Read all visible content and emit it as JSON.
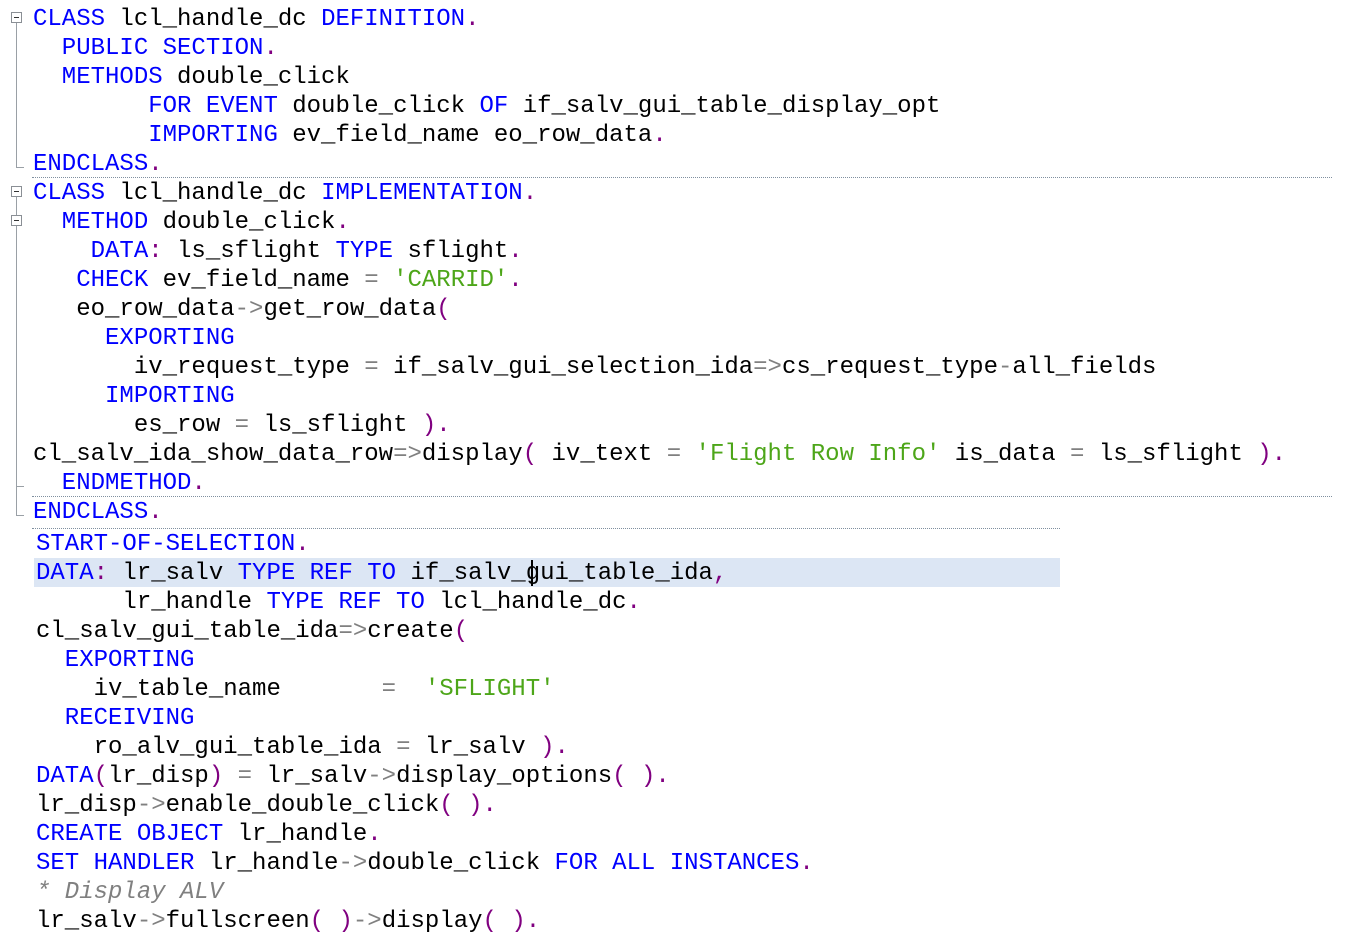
{
  "colors": {
    "keyword": "#0000ff",
    "string": "#4da619",
    "operator": "#808080",
    "punctuation": "#800080",
    "comment": "#808080",
    "current_line": "#dce6f4"
  },
  "lines": [
    [
      [
        "k",
        "CLASS"
      ],
      [
        "i",
        " lcl_handle_dc "
      ],
      [
        "k",
        "DEFINITION"
      ],
      [
        "p",
        "."
      ]
    ],
    [
      [
        "k",
        "  PUBLIC SECTION"
      ],
      [
        "p",
        "."
      ]
    ],
    [
      [
        "k",
        "  METHODS"
      ],
      [
        "i",
        " double_click"
      ]
    ],
    [
      [
        "i",
        "        "
      ],
      [
        "k",
        "FOR EVENT"
      ],
      [
        "i",
        " double_click "
      ],
      [
        "k",
        "OF"
      ],
      [
        "i",
        " if_salv_gui_table_display_opt"
      ]
    ],
    [
      [
        "i",
        "        "
      ],
      [
        "k",
        "IMPORTING"
      ],
      [
        "i",
        " ev_field_name eo_row_data"
      ],
      [
        "p",
        "."
      ]
    ],
    [
      [
        "k",
        "ENDCLASS"
      ],
      [
        "p",
        "."
      ]
    ],
    [
      [
        "k",
        "CLASS"
      ],
      [
        "i",
        " lcl_handle_dc "
      ],
      [
        "k",
        "IMPLEMENTATION"
      ],
      [
        "p",
        "."
      ]
    ],
    [
      [
        "k",
        "  METHOD"
      ],
      [
        "i",
        " double_click"
      ],
      [
        "p",
        "."
      ]
    ],
    [
      [
        "k",
        "    DATA"
      ],
      [
        "p",
        ":"
      ],
      [
        "i",
        " ls_sflight "
      ],
      [
        "k",
        "TYPE"
      ],
      [
        "i",
        " sflight"
      ],
      [
        "p",
        "."
      ]
    ],
    [
      [
        "k",
        "   CHECK"
      ],
      [
        "i",
        " ev_field_name "
      ],
      [
        "o",
        "="
      ],
      [
        "i",
        " "
      ],
      [
        "s",
        "'CARRID'"
      ],
      [
        "p",
        "."
      ]
    ],
    [
      [
        "i",
        "   eo_row_data"
      ],
      [
        "o",
        "->"
      ],
      [
        "i",
        "get_row_data"
      ],
      [
        "p",
        "("
      ]
    ],
    [
      [
        "k",
        "     EXPORTING"
      ]
    ],
    [
      [
        "i",
        "       iv_request_type "
      ],
      [
        "o",
        "="
      ],
      [
        "i",
        " if_salv_gui_selection_ida"
      ],
      [
        "o",
        "=>"
      ],
      [
        "i",
        "cs_request_type"
      ],
      [
        "o",
        "-"
      ],
      [
        "i",
        "all_fields"
      ]
    ],
    [
      [
        "k",
        "     IMPORTING"
      ]
    ],
    [
      [
        "i",
        "       es_row "
      ],
      [
        "o",
        "="
      ],
      [
        "i",
        " ls_sflight "
      ],
      [
        "p",
        ")."
      ]
    ],
    [
      [
        "i",
        "cl_salv_ida_show_data_row"
      ],
      [
        "o",
        "=>"
      ],
      [
        "i",
        "display"
      ],
      [
        "p",
        "("
      ],
      [
        "i",
        " iv_text "
      ],
      [
        "o",
        "="
      ],
      [
        "i",
        " "
      ],
      [
        "s",
        "'Flight Row Info'"
      ],
      [
        "i",
        " is_data "
      ],
      [
        "o",
        "="
      ],
      [
        "i",
        " ls_sflight "
      ],
      [
        "p",
        ")."
      ]
    ],
    [
      [
        "k",
        "  ENDMETHOD"
      ],
      [
        "p",
        "."
      ]
    ],
    [
      [
        "k",
        "ENDCLASS"
      ],
      [
        "p",
        "."
      ]
    ],
    [
      [
        "k",
        "START-OF-SELECTION"
      ],
      [
        "p",
        "."
      ]
    ],
    [
      [
        "k",
        "DATA"
      ],
      [
        "p",
        ":"
      ],
      [
        "i",
        " lr_salv "
      ],
      [
        "k",
        "TYPE REF TO"
      ],
      [
        "i",
        " if_salv_gui_table_ida"
      ],
      [
        "p",
        ","
      ]
    ],
    [
      [
        "i",
        "      lr_handle "
      ],
      [
        "k",
        "TYPE REF TO"
      ],
      [
        "i",
        " lcl_handle_dc"
      ],
      [
        "p",
        "."
      ]
    ],
    [
      [
        "i",
        "cl_salv_gui_table_ida"
      ],
      [
        "o",
        "=>"
      ],
      [
        "i",
        "create"
      ],
      [
        "p",
        "("
      ]
    ],
    [
      [
        "k",
        "  EXPORTING"
      ]
    ],
    [
      [
        "i",
        "    iv_table_name       "
      ],
      [
        "o",
        "="
      ],
      [
        "i",
        "  "
      ],
      [
        "s",
        "'SFLIGHT'"
      ]
    ],
    [
      [
        "k",
        "  RECEIVING"
      ]
    ],
    [
      [
        "i",
        "    ro_alv_gui_table_ida "
      ],
      [
        "o",
        "="
      ],
      [
        "i",
        " lr_salv "
      ],
      [
        "p",
        ")."
      ]
    ],
    [
      [
        "k",
        "DATA"
      ],
      [
        "p",
        "("
      ],
      [
        "i",
        "lr_disp"
      ],
      [
        "p",
        ")"
      ],
      [
        "i",
        " "
      ],
      [
        "o",
        "="
      ],
      [
        "i",
        " lr_salv"
      ],
      [
        "o",
        "->"
      ],
      [
        "i",
        "display_options"
      ],
      [
        "p",
        "("
      ],
      [
        "i",
        " "
      ],
      [
        "p",
        ")."
      ]
    ],
    [
      [
        "i",
        "lr_disp"
      ],
      [
        "o",
        "->"
      ],
      [
        "i",
        "enable_double_click"
      ],
      [
        "p",
        "("
      ],
      [
        "i",
        " "
      ],
      [
        "p",
        ")."
      ]
    ],
    [
      [
        "k",
        "CREATE OBJECT"
      ],
      [
        "i",
        " lr_handle"
      ],
      [
        "p",
        "."
      ]
    ],
    [
      [
        "k",
        "SET HANDLER"
      ],
      [
        "i",
        " lr_handle"
      ],
      [
        "o",
        "->"
      ],
      [
        "i",
        "double_click "
      ],
      [
        "k",
        "FOR ALL INSTANCES"
      ],
      [
        "p",
        "."
      ]
    ],
    [
      [
        "c",
        "* Display ALV"
      ]
    ],
    [
      [
        "i",
        "lr_salv"
      ],
      [
        "o",
        "->"
      ],
      [
        "i",
        "fullscreen"
      ],
      [
        "p",
        "("
      ],
      [
        "i",
        " "
      ],
      [
        "p",
        ")"
      ],
      [
        "o",
        "->"
      ],
      [
        "i",
        "display"
      ],
      [
        "p",
        "("
      ],
      [
        "i",
        " "
      ],
      [
        "p",
        ")."
      ]
    ]
  ]
}
